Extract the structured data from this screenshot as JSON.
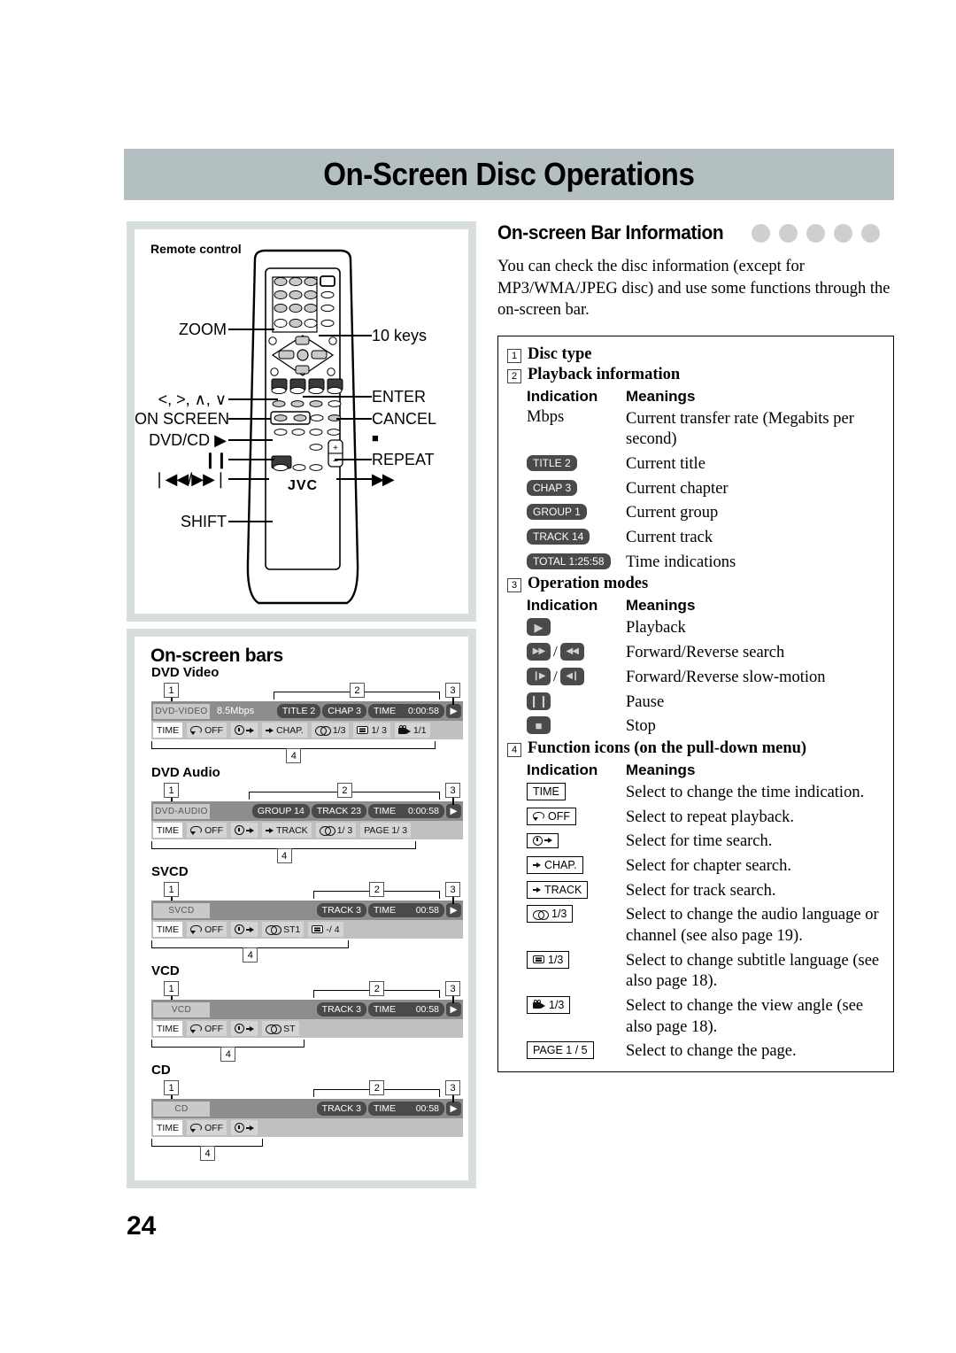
{
  "page": {
    "title": "On-Screen Disc Operations",
    "number": "24"
  },
  "left": {
    "remote_panel": {
      "label": "Remote control",
      "brand": "JVC",
      "callouts_left": [
        {
          "name": "zoom",
          "text": "ZOOM"
        },
        {
          "name": "cursor",
          "text": "<, >, ∧, ∨"
        },
        {
          "name": "on-screen",
          "text": "ON SCREEN"
        },
        {
          "name": "dvd-cd-play",
          "text": "DVD/CD ▶"
        },
        {
          "name": "pause",
          "text": "❙❙"
        },
        {
          "name": "skip",
          "text": "❘◀◀/▶▶❘"
        },
        {
          "name": "shift",
          "text": "SHIFT"
        }
      ],
      "callouts_right": [
        {
          "name": "ten-keys",
          "text": "10 keys"
        },
        {
          "name": "enter",
          "text": "ENTER"
        },
        {
          "name": "cancel",
          "text": "CANCEL"
        },
        {
          "name": "stop",
          "text": "■"
        },
        {
          "name": "repeat",
          "text": "REPEAT"
        },
        {
          "name": "forward",
          "text": "▶▶"
        }
      ]
    },
    "bars_panel": {
      "title": "On-screen bars",
      "markers": {
        "one": "1",
        "two": "2",
        "three": "3",
        "four": "4"
      },
      "bars": [
        {
          "name": "DVD Video",
          "disc_tag": "DVD-VIDEO",
          "rate": "8.5Mbps",
          "pills": [
            {
              "icon": "",
              "text": "TITLE 2"
            },
            {
              "icon": "",
              "text": "CHAP 3"
            },
            {
              "icon": "",
              "text": "TIME",
              "value": "0:00:58"
            }
          ],
          "play_icon": "play-icon",
          "functions": [
            {
              "icon": "",
              "text": "TIME",
              "white": true
            },
            {
              "icon": "repeat-icon",
              "text": "OFF"
            },
            {
              "icon": "clock-arrow-icon",
              "text": ""
            },
            {
              "icon": "arrow-icon",
              "text": "CHAP."
            },
            {
              "icon": "audio-icon",
              "text": "1/3"
            },
            {
              "icon": "subtitle-icon",
              "text": "1/ 3"
            },
            {
              "icon": "angle-icon",
              "text": "1/1"
            }
          ]
        },
        {
          "name": "DVD Audio",
          "disc_tag": "DVD-AUDIO",
          "rate": "",
          "pills": [
            {
              "icon": "",
              "text": "GROUP 14"
            },
            {
              "icon": "",
              "text": "TRACK 23"
            },
            {
              "icon": "",
              "text": "TIME",
              "value": "0:00:58"
            }
          ],
          "play_icon": "play-icon",
          "functions": [
            {
              "icon": "",
              "text": "TIME",
              "white": true
            },
            {
              "icon": "repeat-icon",
              "text": "OFF"
            },
            {
              "icon": "clock-arrow-icon",
              "text": ""
            },
            {
              "icon": "arrow-icon",
              "text": "TRACK"
            },
            {
              "icon": "audio-icon",
              "text": "1/ 3"
            },
            {
              "icon": "",
              "text": "PAGE 1/ 3"
            }
          ]
        },
        {
          "name": "SVCD",
          "disc_tag": "SVCD",
          "rate": "",
          "pills": [
            {
              "icon": "",
              "text": "TRACK 3"
            },
            {
              "icon": "",
              "text": "TIME",
              "value": "00:58"
            }
          ],
          "play_icon": "play-icon",
          "functions": [
            {
              "icon": "",
              "text": "TIME",
              "white": true
            },
            {
              "icon": "repeat-icon",
              "text": "OFF"
            },
            {
              "icon": "clock-arrow-icon",
              "text": ""
            },
            {
              "icon": "audio-icon",
              "text": "ST1"
            },
            {
              "icon": "subtitle-icon",
              "text": "-/ 4"
            }
          ]
        },
        {
          "name": "VCD",
          "disc_tag": "VCD",
          "rate": "",
          "pills": [
            {
              "icon": "",
              "text": "TRACK 3"
            },
            {
              "icon": "",
              "text": "TIME",
              "value": "00:58"
            }
          ],
          "play_icon": "play-icon",
          "functions": [
            {
              "icon": "",
              "text": "TIME",
              "white": true
            },
            {
              "icon": "repeat-icon",
              "text": "OFF"
            },
            {
              "icon": "clock-arrow-icon",
              "text": ""
            },
            {
              "icon": "audio-icon",
              "text": "ST"
            }
          ]
        },
        {
          "name": "CD",
          "disc_tag": "CD",
          "rate": "",
          "pills": [
            {
              "icon": "",
              "text": "TRACK 3"
            },
            {
              "icon": "",
              "text": "TIME",
              "value": "00:58"
            }
          ],
          "play_icon": "play-icon",
          "functions": [
            {
              "icon": "",
              "text": "TIME",
              "white": true
            },
            {
              "icon": "repeat-icon",
              "text": "OFF"
            },
            {
              "icon": "clock-arrow-icon",
              "text": ""
            }
          ]
        }
      ]
    }
  },
  "right": {
    "heading": "On-screen Bar Information",
    "disc_dots": 5,
    "intro": "You can check the disc information (except for MP3/WMA/JPEG disc) and use some functions through the on-screen bar.",
    "sections": [
      {
        "num": "1",
        "title": "Disc type",
        "rows": []
      },
      {
        "num": "2",
        "title": "Playback information",
        "col1": "Indication",
        "col2": "Meanings",
        "rows": [
          {
            "style": "plain",
            "ind": "Mbps",
            "mean": "Current transfer rate (Megabits per second)"
          },
          {
            "style": "dark",
            "ind": "TITLE 2",
            "mean": "Current title"
          },
          {
            "style": "dark",
            "ind": "CHAP 3",
            "mean": "Current chapter"
          },
          {
            "style": "dark",
            "ind": "GROUP 1",
            "mean": "Current group"
          },
          {
            "style": "dark",
            "ind": "TRACK 14",
            "mean": "Current track"
          },
          {
            "style": "dark",
            "ind": "TOTAL 1:25:58",
            "mean": "Time indications"
          }
        ]
      },
      {
        "num": "3",
        "title": "Operation modes",
        "col1": "Indication",
        "col2": "Meanings",
        "rows": [
          {
            "style": "mode",
            "icons": [
              "play-icon"
            ],
            "mean": "Playback"
          },
          {
            "style": "modepair",
            "icons": [
              "fast-forward-icon",
              "rewind-icon"
            ],
            "mean": "Forward/Reverse search"
          },
          {
            "style": "modepair",
            "icons": [
              "slow-forward-icon",
              "slow-reverse-icon"
            ],
            "mean": "Forward/Reverse slow-motion"
          },
          {
            "style": "mode",
            "icons": [
              "pause-icon"
            ],
            "mean": "Pause"
          },
          {
            "style": "mode",
            "icons": [
              "stop-icon"
            ],
            "mean": "Stop"
          }
        ]
      },
      {
        "num": "4",
        "title": "Function icons (on the pull-down menu)",
        "col1": "Indication",
        "col2": "Meanings",
        "rows": [
          {
            "style": "box",
            "icon": "",
            "ind": "TIME",
            "mean": "Select to change the time indication."
          },
          {
            "style": "box",
            "icon": "repeat-icon",
            "ind": "OFF",
            "mean": "Select to repeat playback."
          },
          {
            "style": "box",
            "icon": "clock-arrow-icon",
            "ind": "",
            "mean": "Select for time search."
          },
          {
            "style": "box",
            "icon": "arrow-icon",
            "ind": "CHAP.",
            "mean": "Select for chapter search."
          },
          {
            "style": "box",
            "icon": "arrow-icon",
            "ind": "TRACK",
            "mean": "Select for track search."
          },
          {
            "style": "box",
            "icon": "audio-icon",
            "ind": "1/3",
            "mean": "Select to change the audio language or channel (see also page 19)."
          },
          {
            "style": "box",
            "icon": "subtitle-icon",
            "ind": "1/3",
            "mean": "Select to change subtitle language (see also page 18)."
          },
          {
            "style": "box",
            "icon": "angle-icon",
            "ind": "1/3",
            "mean": "Select to change the view angle (see also page 18)."
          },
          {
            "style": "box",
            "icon": "",
            "ind": "PAGE 1 / 5",
            "mean": "Select to change the page."
          }
        ]
      }
    ]
  }
}
